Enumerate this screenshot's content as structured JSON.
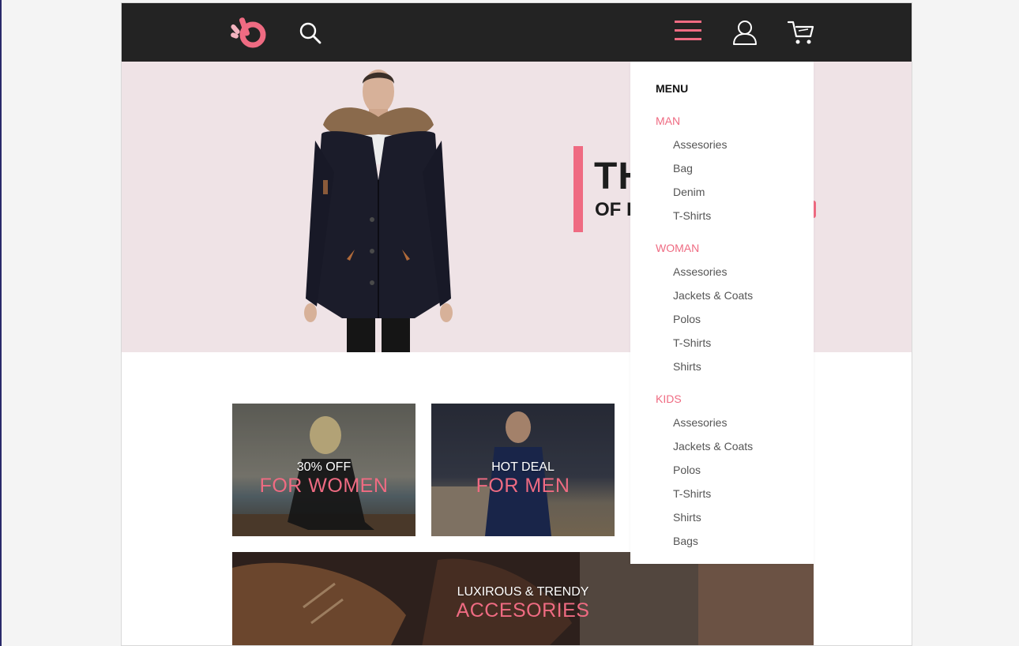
{
  "header": {
    "logo_icon": "brand-logo-icon",
    "search_icon": "search-icon",
    "menu_icon": "hamburger-menu-icon",
    "user_icon": "user-icon",
    "cart_icon": "cart-icon"
  },
  "colors": {
    "accent": "#ef6b82",
    "topbar": "#232323",
    "hero_bg": "#efe3e6"
  },
  "hero": {
    "title": "TH",
    "subtitle": "OF L"
  },
  "promos": {
    "women": {
      "caption": "30% OFF",
      "headline": "FOR WOMEN"
    },
    "men": {
      "caption": "HOT DEAL",
      "headline": "FOR MEN"
    },
    "accessories": {
      "caption": "LUXIROUS & TRENDY",
      "headline": "ACCESORIES"
    }
  },
  "menu": {
    "title": "MENU",
    "sections": [
      {
        "label": "MAN",
        "items": [
          "Assesories",
          "Bag",
          "Denim",
          "T-Shirts"
        ]
      },
      {
        "label": "WOMAN",
        "items": [
          "Assesories",
          "Jackets & Coats",
          "Polos",
          "T-Shirts",
          "Shirts"
        ]
      },
      {
        "label": "KIDS",
        "items": [
          "Assesories",
          "Jackets & Coats",
          "Polos",
          "T-Shirts",
          "Shirts",
          "Bags"
        ]
      }
    ]
  }
}
